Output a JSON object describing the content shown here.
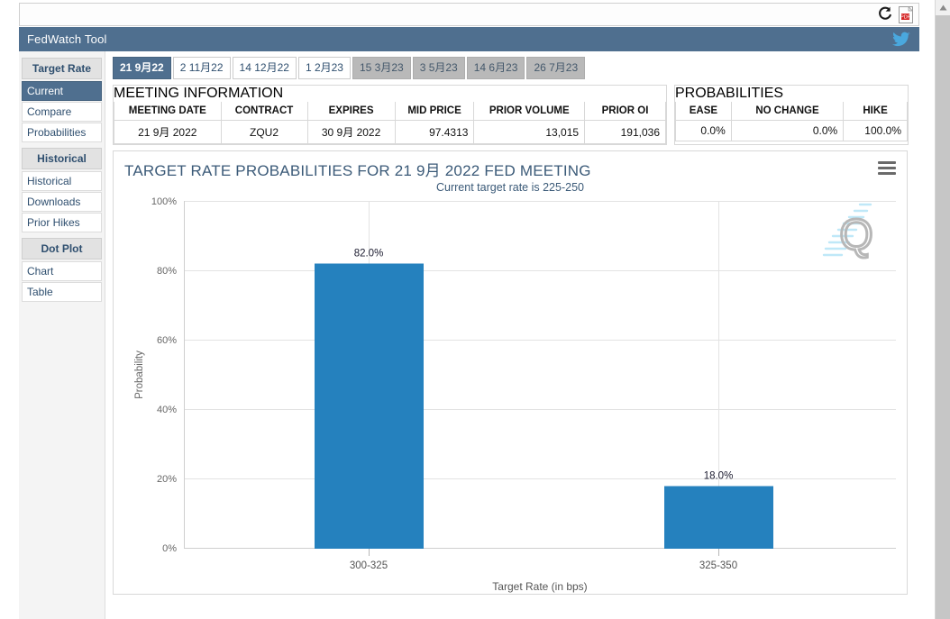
{
  "browser": {
    "refresh_icon": "refresh-icon",
    "pdf_icon": "pdf-icon",
    "scroll_up_icon": "scroll-up-arrow-icon"
  },
  "header": {
    "title": "FedWatch Tool",
    "twitter_icon": "twitter-icon",
    "bar_color": "#4f6f8f"
  },
  "sidebar": {
    "groups": [
      {
        "header": "Target Rate",
        "items": [
          {
            "label": "Current",
            "active": true
          },
          {
            "label": "Compare",
            "active": false
          },
          {
            "label": "Probabilities",
            "active": false
          }
        ]
      },
      {
        "header": "Historical",
        "items": [
          {
            "label": "Historical",
            "active": false
          },
          {
            "label": "Downloads",
            "active": false
          },
          {
            "label": "Prior Hikes",
            "active": false
          }
        ]
      },
      {
        "header": "Dot Plot",
        "items": [
          {
            "label": "Chart",
            "active": false
          },
          {
            "label": "Table",
            "active": false
          }
        ]
      }
    ]
  },
  "tabs": [
    {
      "label": "21 9月22",
      "state": "active"
    },
    {
      "label": "2 11月22",
      "state": "normal"
    },
    {
      "label": "14 12月22",
      "state": "normal"
    },
    {
      "label": "1 2月23",
      "state": "normal"
    },
    {
      "label": "15 3月23",
      "state": "disabled"
    },
    {
      "label": "3 5月23",
      "state": "disabled"
    },
    {
      "label": "14 6月23",
      "state": "disabled"
    },
    {
      "label": "26 7月23",
      "state": "disabled"
    }
  ],
  "meeting_information": {
    "caption": "MEETING INFORMATION",
    "columns": [
      "MEETING DATE",
      "CONTRACT",
      "EXPIRES",
      "MID PRICE",
      "PRIOR VOLUME",
      "PRIOR OI"
    ],
    "row": [
      "21 9月 2022",
      "ZQU2",
      "30 9月 2022",
      "97.4313",
      "13,015",
      "191,036"
    ]
  },
  "probabilities": {
    "caption": "PROBABILITIES",
    "columns": [
      "EASE",
      "NO CHANGE",
      "HIKE"
    ],
    "row": [
      "0.0%",
      "0.0%",
      "100.0%"
    ]
  },
  "chart_data": {
    "type": "bar",
    "title": "TARGET RATE PROBABILITIES FOR 21 9月 2022 FED MEETING",
    "subtitle": "Current target rate is 225-250",
    "categories": [
      "300-325",
      "325-350"
    ],
    "values": [
      82.0,
      18.0
    ],
    "data_labels": [
      "82.0%",
      "18.0%"
    ],
    "xlabel": "Target Rate (in bps)",
    "ylabel": "Probability",
    "ylim": [
      0,
      100
    ],
    "yticks": [
      0,
      20,
      40,
      60,
      80,
      100
    ],
    "ytick_labels": [
      "0%",
      "20%",
      "40%",
      "60%",
      "80%",
      "100%"
    ],
    "grid": true,
    "legend": "none",
    "bar_color": "#2581be",
    "menu_icon": "hamburger-menu-icon",
    "watermark": "Q"
  }
}
